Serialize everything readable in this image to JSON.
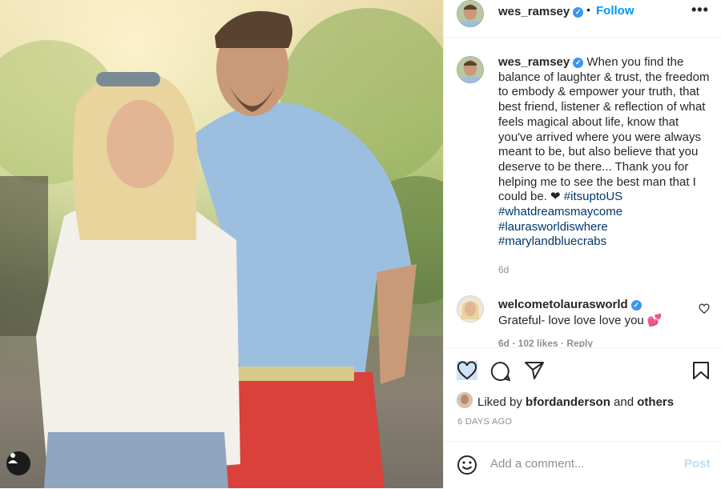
{
  "post": {
    "header": {
      "username": "wes_ramsey",
      "verified_glyph": "✓",
      "separator": "•",
      "follow_label": "Follow",
      "more_glyph": "•••"
    },
    "caption": {
      "username": "wes_ramsey",
      "text": "When you find the balance of laughter & trust, the freedom to embody & empower your truth, that best friend, listener & reflection of what feels magical about life, know that you've arrived where you were always meant to be, but also believe that you deserve to be there... Thank you for helping me to see the best man that I could be. ❤ ",
      "hashtags": [
        "#itsuptoUS",
        "#whatdreamsmaycome",
        "#laurasworldiswhere",
        "#marylandbluecrabs"
      ],
      "time": "6d"
    },
    "comment": {
      "username": "welcometolaurasworld",
      "text": "Grateful- love love love you 💕",
      "meta": "6d · 102 likes · Reply"
    },
    "likes": {
      "prefix": "Liked by ",
      "user": "bfordanderson",
      "middle": " and ",
      "others": "others"
    },
    "date": "6 DAYS AGO",
    "add_comment": {
      "placeholder": "Add a comment...",
      "post_label": "Post"
    },
    "icons": [
      "heart-icon",
      "comment-icon",
      "share-icon",
      "bookmark-icon",
      "emoji-icon",
      "user-tag-icon",
      "more-icon"
    ],
    "colors": {
      "link": "#0095f6",
      "hashtag": "#00376b",
      "muted": "#8e8e8e",
      "verified": "#3897f0"
    }
  }
}
